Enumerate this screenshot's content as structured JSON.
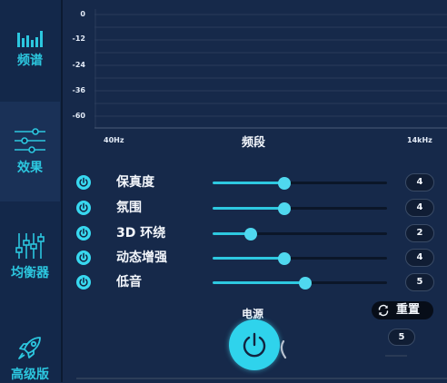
{
  "sidebar": {
    "items": [
      {
        "label": "频谱",
        "icon": "spectrum-icon"
      },
      {
        "label": "效果",
        "icon": "sliders-icon"
      },
      {
        "label": "均衡器",
        "icon": "equalizer-icon"
      },
      {
        "label": "高级版",
        "icon": "rocket-icon"
      }
    ],
    "active_index": 1
  },
  "spectrum": {
    "title": "频段",
    "y_ticks": [
      "0",
      "-12",
      "-24",
      "-36",
      "-60"
    ],
    "x_start": "40Hz",
    "x_end": "14kHz"
  },
  "effects": [
    {
      "label": "保真度",
      "value": "4",
      "level": 0.41
    },
    {
      "label": "氛围",
      "value": "4",
      "level": 0.41
    },
    {
      "label": "3D 环绕",
      "value": "2",
      "level": 0.22
    },
    {
      "label": "动态增强",
      "value": "4",
      "level": 0.41
    },
    {
      "label": "低音",
      "value": "5",
      "level": 0.53
    }
  ],
  "power": {
    "label": "电源"
  },
  "reset": {
    "label": "重置"
  },
  "preset_value": "5",
  "colors": {
    "background": "#16294a",
    "sidebar": "#13284a",
    "accent": "#2fd3ec",
    "track": "#0b1628"
  }
}
